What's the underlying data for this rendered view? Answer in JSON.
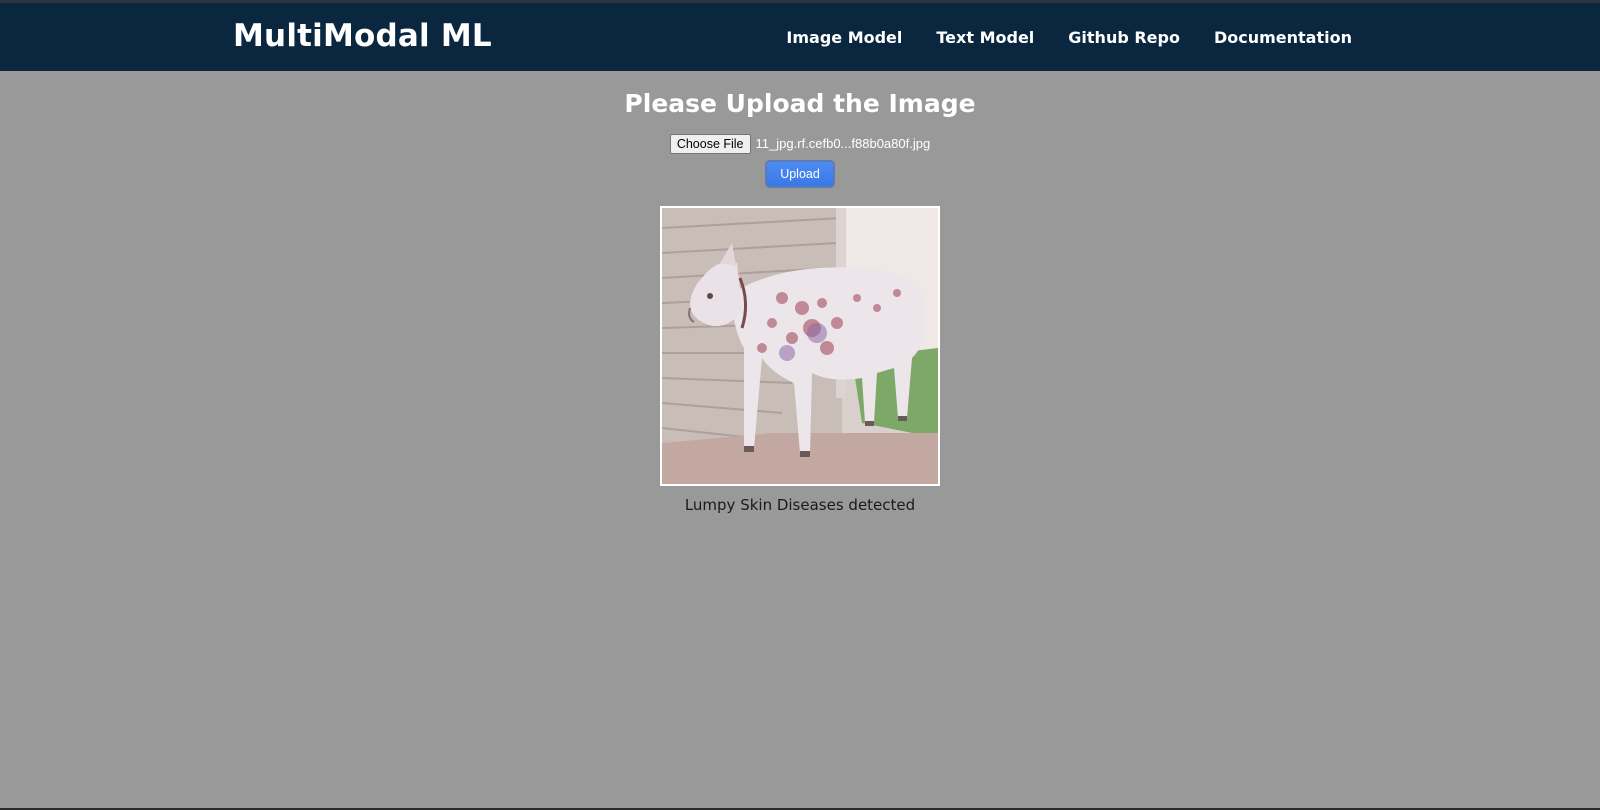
{
  "header": {
    "brand": "MultiModal ML",
    "nav": [
      {
        "label": "Image Model"
      },
      {
        "label": "Text Model"
      },
      {
        "label": "Github Repo"
      },
      {
        "label": "Documentation"
      }
    ]
  },
  "main": {
    "title": "Please Upload the Image",
    "file_input": {
      "button_label": "Choose File",
      "file_name": "11_jpg.rf.cefb0...f88b0a80f.jpg"
    },
    "upload_label": "Upload",
    "preview_icon": "cow-photo",
    "result": "Lumpy Skin Diseases detected"
  },
  "colors": {
    "navbar": "#0b2740",
    "background": "#999999",
    "accent": "#3a78e6"
  }
}
